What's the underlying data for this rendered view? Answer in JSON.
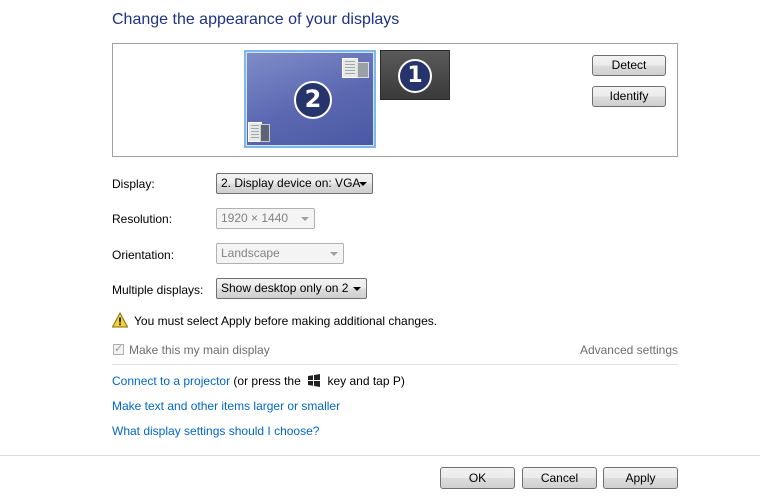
{
  "title": "Change the appearance of your displays",
  "preview": {
    "monitor2_number": "2",
    "monitor1_number": "1",
    "detect_label": "Detect",
    "identify_label": "Identify"
  },
  "fields": {
    "display_label": "Display:",
    "display_value": "2. Display device on: VGA",
    "resolution_label": "Resolution:",
    "resolution_value": "1920 × 1440",
    "orientation_label": "Orientation:",
    "orientation_value": "Landscape",
    "multiple_label": "Multiple displays:",
    "multiple_value": "Show desktop only on 2"
  },
  "warning": {
    "text": "You must select Apply before making additional changes.",
    "icon": "warning-icon"
  },
  "main_display": {
    "label": "Make this my main display",
    "checked": true,
    "advanced_link": "Advanced settings"
  },
  "links": {
    "projector_link": "Connect to a projector",
    "projector_text_before": "(or press the",
    "projector_text_after": "key and tap P)",
    "text_size_link": "Make text and other items larger or smaller",
    "help_link": "What display settings should I choose?"
  },
  "buttons": {
    "ok": "OK",
    "cancel": "Cancel",
    "apply": "Apply"
  },
  "colors": {
    "title": "#1e3287",
    "link": "#0066cc",
    "selected_monitor": "#5b68b1"
  }
}
